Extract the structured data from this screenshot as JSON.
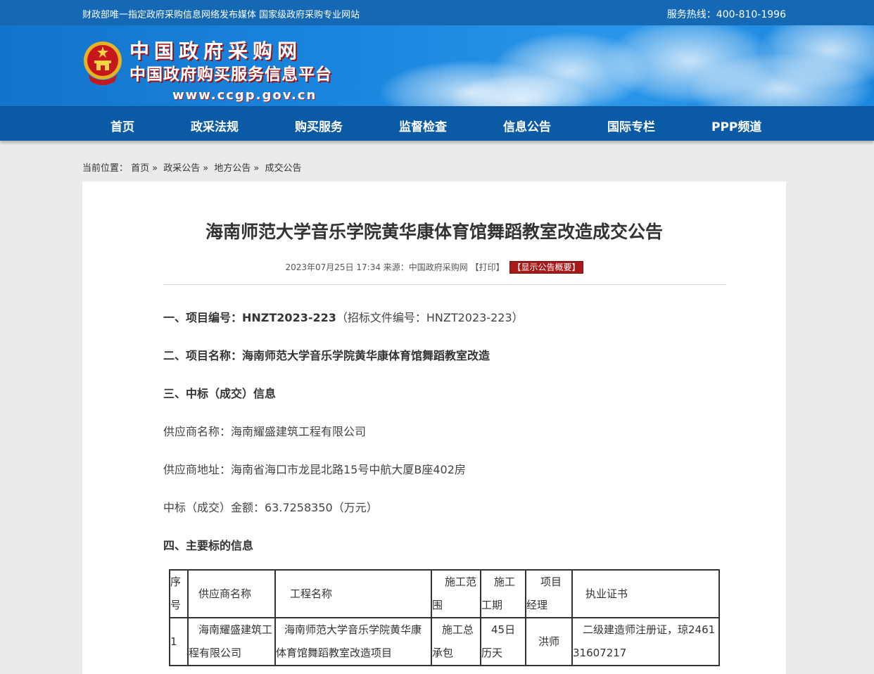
{
  "topbar": {
    "slogan": "财政部唯一指定政府采购信息网络发布媒体 国家级政府采购专业网站",
    "hotline": "服务热线：400-810-1996"
  },
  "logo": {
    "title": "中国政府采购网",
    "subtitle": "中国政府购买服务信息平台",
    "url": "www.ccgp.gov.cn",
    "emblem_icon": "national-emblem-icon"
  },
  "nav": {
    "items": [
      "首页",
      "政采法规",
      "购买服务",
      "监督检查",
      "信息公告",
      "国际专栏",
      "PPP频道"
    ]
  },
  "breadcrumb": {
    "prefix": "当前位置：",
    "items": [
      "首页",
      "政采公告",
      "地方公告",
      "成交公告"
    ],
    "separator": "»"
  },
  "article": {
    "title": "海南师范大学音乐学院黄华康体育馆舞蹈教室改造成交公告",
    "date": "2023年07月25日 17:34",
    "source": "来源：中国政府采购网",
    "print": "【打印】",
    "summary_button": "【显示公告概要】",
    "sections": {
      "s1_label": "一、项目编号：HNZT2023-223",
      "s1_note": "（招标文件编号：HNZT2023-223）",
      "s2": "二、项目名称：海南师范大学音乐学院黄华康体育馆舞蹈教室改造",
      "s3": "三、中标（成交）信息",
      "supplier_name": "供应商名称：海南耀盛建筑工程有限公司",
      "supplier_address": "供应商地址：海南省海口市龙昆北路15号中航大厦B座402房",
      "amount": "中标（成交）金额：63.7258350（万元）",
      "s4": "四、主要标的信息"
    },
    "table": {
      "headers": [
        "序号",
        "供应商名称",
        "工程名称",
        "施工范围",
        "施工工期",
        "项目经理",
        "执业证书"
      ],
      "rows": [
        [
          "1",
          "海南耀盛建筑工程有限公司",
          "海南师范大学音乐学院黄华康体育馆舞蹈教室改造项目",
          "施工总承包",
          "45日历天",
          "洪师",
          "二级建造师注册证，琼246131607217"
        ]
      ]
    }
  },
  "colors": {
    "topbar": "#1468b4",
    "nav": "#0b5aa6",
    "summary_button": "#a71a1a"
  }
}
